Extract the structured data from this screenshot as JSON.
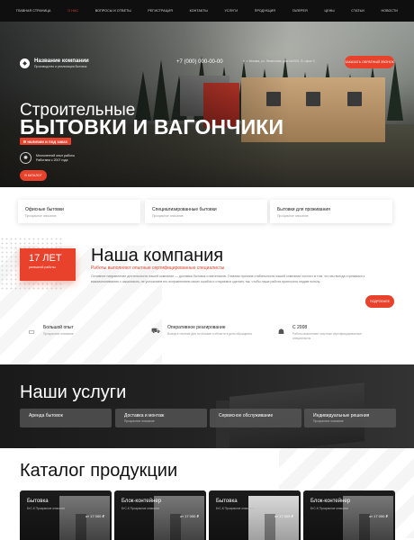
{
  "nav": {
    "items": [
      {
        "label": "Главная страница",
        "active": false
      },
      {
        "label": "О нас",
        "active": true
      },
      {
        "label": "Вопросы и ответы",
        "active": false
      },
      {
        "label": "Регистрация",
        "active": false
      },
      {
        "label": "Контакты",
        "active": false
      },
      {
        "label": "Услуги",
        "active": false
      },
      {
        "label": "Продукция",
        "active": false
      },
      {
        "label": "Галерея",
        "active": false
      },
      {
        "label": "Цены",
        "active": false
      },
      {
        "label": "Статьи",
        "active": false
      },
      {
        "label": "Новости",
        "active": false
      }
    ]
  },
  "header": {
    "company_name": "Название компании",
    "company_tagline": "Производство и реализация бытовок",
    "phone": "+7 (000) 000-00-00",
    "address": "г. Москва, ул. Ленинская, дом №0001, В, офис 0",
    "callback_label": "Заказать обратный звонок"
  },
  "hero": {
    "title_line1": "Строительные",
    "title_line2": "бытовки и вагончики",
    "stock_label": "В наличии и под заказ",
    "experience_line1": "Многолетний опыт работы",
    "experience_line2": "Работаем с 2007 года",
    "catalog_button": "В каталог"
  },
  "categories": [
    {
      "title": "Офисные бытовки",
      "subtitle": "Прозрачное описание"
    },
    {
      "title": "Специализированные бытовки",
      "subtitle": "Прозрачное описание"
    },
    {
      "title": "Бытовки для проживания",
      "subtitle": "Прозрачное описание"
    }
  ],
  "company": {
    "years": "17 ЛЕТ",
    "years_caption": "успешной работы",
    "title": "Наша компания",
    "subtitle": "Работы выполняют опытные сертифицированные специалисты",
    "text": "Основное направление деятельности нашей компании — доставка бытовок и вагончиков. Главная причина стабильности нашей компании состоит в том, что мы всегда стремимся к взаимопониманию с заказчиком, не усложняем его исправлением своих ошибок и стараемся сделать так, чтобы наша работа приносила людям пользу.",
    "more_button": "Подробнее",
    "features": [
      {
        "title": "Большой опыт",
        "subtitle": "Прозрачное описание"
      },
      {
        "title": "Оперативное реагирование",
        "subtitle": "Выезд в течение дня по Москве и области в день обращения"
      },
      {
        "title": "С 2008",
        "subtitle": "Работы выполняют опытные сертифицированные специалисты"
      }
    ]
  },
  "services": {
    "title": "Наши услуги",
    "items": [
      {
        "name": "Аренда бытовок",
        "subtitle": ""
      },
      {
        "name": "Доставка и монтаж",
        "subtitle": "Прозрачное описание"
      },
      {
        "name": "Сервисное обслуживание",
        "subtitle": ""
      },
      {
        "name": "Индивидуальные решения",
        "subtitle": "Прозрачное описание"
      }
    ]
  },
  "catalog": {
    "title": "Каталог продукции",
    "products": [
      {
        "name": "Бытовка",
        "subtitle": "БтС-К Прозрачное описание",
        "price": "от 17 000 ₽"
      },
      {
        "name": "Блок-контейнер",
        "subtitle": "БтС-К Прозрачное описание",
        "price": "от 17 000 ₽"
      },
      {
        "name": "Бытовка",
        "subtitle": "БтС-К Прозрачное описание",
        "price": "от 17 000 ₽"
      },
      {
        "name": "Блок-контейнер",
        "subtitle": "БтС-К Прозрачное описание",
        "price": "от 17 000 ₽"
      }
    ]
  },
  "colors": {
    "accent": "#e8412c",
    "dark": "#0f0f0f"
  }
}
